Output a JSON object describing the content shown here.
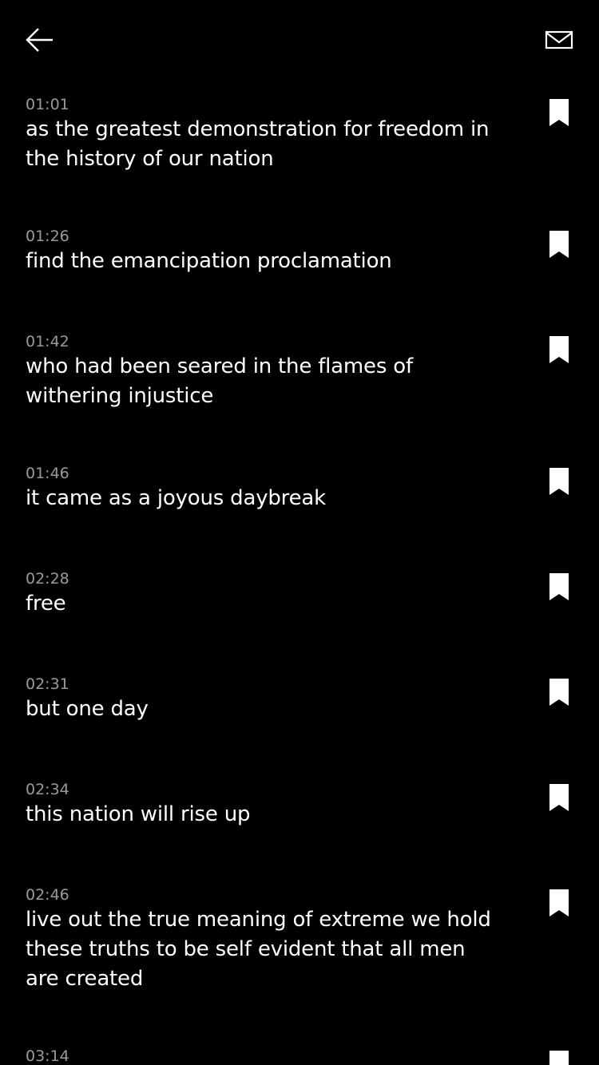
{
  "header": {
    "back_icon": "arrow-left-icon",
    "mail_icon": "mail-icon"
  },
  "transcript": [
    {
      "time": "01:01",
      "text": "as the greatest demonstration for freedom in the history of our nation"
    },
    {
      "time": "01:26",
      "text": "find the emancipation proclamation"
    },
    {
      "time": "01:42",
      "text": "who had been seared in the flames of withering injustice"
    },
    {
      "time": "01:46",
      "text": "it came as a joyous daybreak"
    },
    {
      "time": "02:28",
      "text": "free"
    },
    {
      "time": "02:31",
      "text": "but one day"
    },
    {
      "time": "02:34",
      "text": "this nation will rise up"
    },
    {
      "time": "02:46",
      "text": "live out the true meaning of extreme we hold these truths to be self evident that all men are created"
    },
    {
      "time": "03:14",
      "text": ""
    }
  ],
  "bookmark_icon": "bookmark-icon",
  "colors": {
    "background": "#000000",
    "text": "#ffffff",
    "timestamp": "#9a9a9a"
  }
}
